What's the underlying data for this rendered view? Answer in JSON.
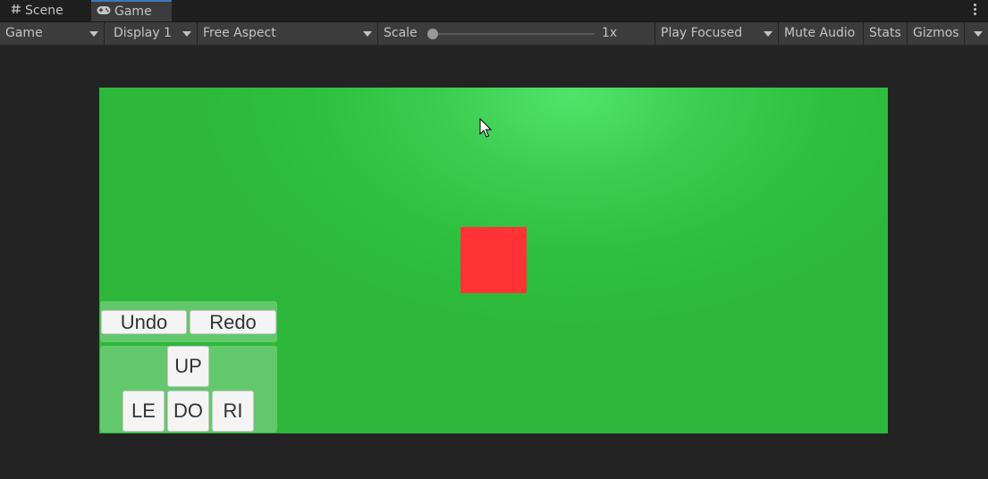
{
  "tabs": [
    {
      "label": "Scene",
      "icon": "hash-icon"
    },
    {
      "label": "Game",
      "icon": "gamepad-icon",
      "active": true
    }
  ],
  "toolbar": {
    "game_view_label": "Game",
    "display_label": "Display 1",
    "aspect_label": "Free Aspect",
    "scale_label": "Scale",
    "scale_value": "1x",
    "scale_slider_level": 0,
    "play_mode_label": "Play Focused",
    "mute_label": "Mute Audio",
    "stats_label": "Stats",
    "gizmos_label": "Gizmos"
  },
  "game": {
    "background_color": "#2fbf3e",
    "player_color": "#ff3336",
    "buttons": {
      "undo": "Undo",
      "redo": "Redo",
      "up": "UP",
      "left": "LE",
      "down": "DO",
      "right": "RI"
    }
  }
}
